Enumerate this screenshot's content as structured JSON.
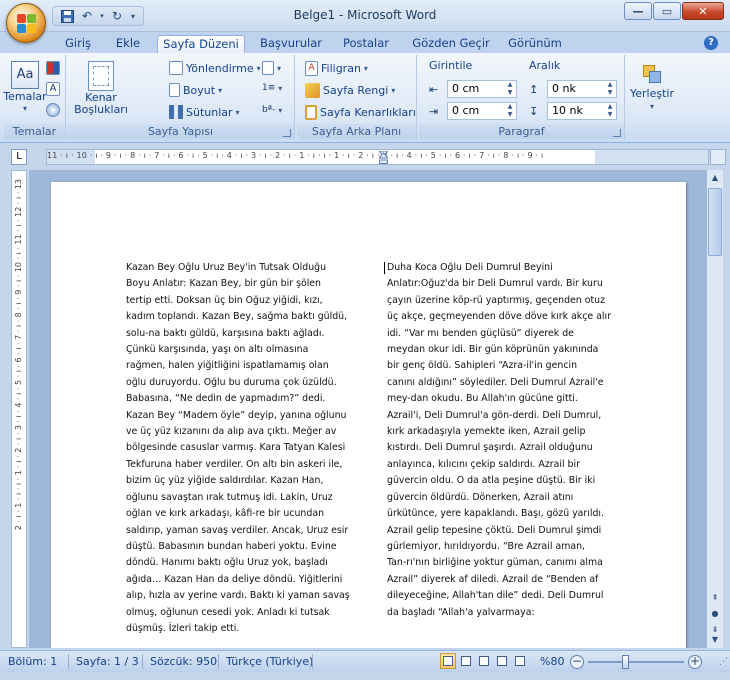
{
  "window": {
    "title": "Belge1 - Microsoft Word"
  },
  "quick_access": {
    "save_icon": "save-icon",
    "undo_icon": "undo-icon",
    "redo_icon": "redo-icon",
    "customize_icon": "customize-icon"
  },
  "tabs": [
    {
      "label": "Giriş"
    },
    {
      "label": "Ekle"
    },
    {
      "label": "Sayfa Düzeni",
      "active": true
    },
    {
      "label": "Başvurular"
    },
    {
      "label": "Postalar"
    },
    {
      "label": "Gözden Geçir"
    },
    {
      "label": "Görünüm"
    }
  ],
  "ribbon": {
    "temalar": {
      "group_label": "Temalar",
      "themes_label": "Temalar"
    },
    "sayfa_yapisi": {
      "group_label": "Sayfa Yapısı",
      "margins_label": "Kenar Boşlukları",
      "orientation_label": "Yönlendirme",
      "size_label": "Boyut",
      "columns_label": "Sütunlar"
    },
    "sayfa_arka_plani": {
      "group_label": "Sayfa Arka Planı",
      "watermark_label": "Filigran",
      "page_color_label": "Sayfa Rengi",
      "page_borders_label": "Sayfa Kenarlıkları"
    },
    "paragraf": {
      "group_label": "Paragraf",
      "indent_label": "Girintile",
      "spacing_label": "Aralık",
      "indent_left": "0 cm",
      "indent_right": "0 cm",
      "spacing_before": "0 nk",
      "spacing_after": "10 nk"
    },
    "yerlestir": {
      "label": "Yerleştir"
    }
  },
  "ruler": {
    "corner": "L",
    "ticks": "11 · ı · 10 · ı · 9 · ı · 8 · ı · 7 · ı · 6 · ı · 5 · ı · 4 · ı · 3 · ı · 2 · ı · 1 · ı · ı · 1 · ı · 2 · ı · 3 · ı · 4 · ı · 5 · ı · 6 · ı · 7 · ı · 8 · ı · 9 · ı",
    "vticks": "2 · ı · 1 · ı · ı · 1 · ı · 2 · ı · 3 · ı · 4 · ı · 5 · ı · 6 · ı · 7 · ı · 8 · ı · 9 · ı · 10 · ı · 11 · ı · 12 · ı · 13"
  },
  "document": {
    "column_left": [
      "Kazan Bey Oğlu Uruz Bey'in Tutsak Olduğu",
      "Boyu Anlatır: Kazan Bey, bir gün bir şölen",
      "tertip etti. Doksan üç bin Oğuz yiğidi, kızı,",
      "kadım toplandı. Kazan Bey, sağma baktı güldü,",
      "solu-na baktı güldü, karşısına baktı ağladı.",
      "Çünkü karşısında, yaşı on altı olmasına",
      "rağmen, halen yiğitliğini ispatlamamış olan",
      "oğlu duruyordu.  Oğlu bu duruma çok üzüldü.",
      "Babasına, “Ne dedin de yapmadım?” dedi.",
      "Kazan Bey “Madem öyle” deyip, yanına oğlunu",
      "ve üç yüz kızanını da alıp ava çıktı. Meğer av",
      "bölgesinde casuslar varmış. Kara Tatyan Kalesi",
      "Tekfuruna haber verdiler. On altı bin askeri ile,",
      "bizim üç yüz yiğide saldırdılar. Kazan Han,",
      "oğlunu savaştan ırak tutmuş idi. Lakin, Uruz",
      "oğlan ve kırk arkadaşı, kâfi-re bir ucundan",
      "saldırıp, yaman savaş verdiler. Ancak, Uruz esir",
      "düştü. Babasının bundan haberi yoktu.  Evine",
      "döndü. Hanımı baktı oğlu Uruz yok, başladı",
      "ağıda… Kazan Han da deliye döndü. Yiğitlerini",
      "alıp, hızla av yerine vardı. Baktı ki yaman savaş",
      "olmuş, oğlunun cesedi yok. Anladı ki tutsak",
      "düşmüş. İzleri takip etti."
    ],
    "column_right": [
      "Duha Koca  Oğlu Deli Dumrul Beyini",
      "Anlatır:Oğuz'da bir Deli Dumrul vardı. Bir kuru",
      "çayın üzerine köp-rü yaptırmış, geçenden otuz",
      "üç akçe, geçmeyenden döve döve  kırk akçe alır",
      "idi. “Var mı benden güçlüsü” diyerek de",
      "meydan okur idi. Bir gün köprünün  yakınında",
      "bir genç öldü. Sahipleri “Azra-il'in gencin",
      "canını aldığını” söylediler. Deli Dumrul Azrail'e",
      "mey-dan okudu. Bu Allah'ın gücüne gitti.",
      "Azrail'i, Deli Dumrul'a gön-derdi. Deli Dumrul,",
      "kırk arkadaşıyla yemekte iken, Azrail gelip",
      "kıstırdı. Deli Dumrul şaşırdı. Azrail olduğunu",
      "anlayınca, kılıcını çekip saldırdı. Azrail bir",
      "güvercin oldu. O da atla peşine düştü. Bir iki",
      "güvercin öldürdü. Dönerken,  Azrail atını",
      "ürkütünce, yere kapaklandı. Başı, gözü yarıldı.",
      "Azrail gelip tepesine çöktü. Deli Dumrul şimdi",
      "gürlemiyor, hırıldıyordu. “Bre Azrail aman,",
      "Tan-rı'nın birliğine yoktur güman, canımı alma",
      "Azrail” diyerek af diledi. Azrail de “Benden af",
      "dileyeceğine, Allah'tan dile” dedi. Deli Dumrul",
      "da başladı “Allah'a yalvarmaya:"
    ]
  },
  "status": {
    "section": "Bölüm: 1",
    "page": "Sayfa: 1 / 3",
    "words": "Sözcük: 950",
    "language": "Türkçe (Türkiye)",
    "zoom": "%80",
    "zoom_level_percent": 80
  },
  "colors": {
    "accent": "#15428b",
    "ribbon_bg": "#dde8f6",
    "frame": "#c4d5ec"
  }
}
